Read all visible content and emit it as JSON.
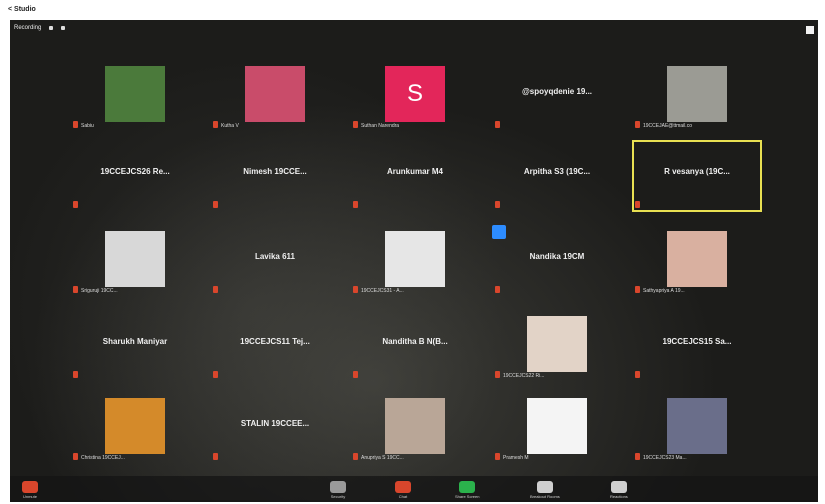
{
  "window": {
    "title": "< Studio"
  },
  "recording": {
    "label": "Recording"
  },
  "tiles": [
    {
      "name": "Sabiu",
      "kind": "photo",
      "photo_color": "#4b7a3b"
    },
    {
      "name": "Kutha V",
      "kind": "photo",
      "photo_color": "#c94c6a"
    },
    {
      "name": "Suthan Narendra",
      "kind": "letter",
      "letter": "S"
    },
    {
      "name": "@spoyqdenie 19...",
      "kind": "name"
    },
    {
      "name": "19CCEJAE@ttmail.co",
      "kind": "photo",
      "photo_color": "#9b9b94"
    },
    {
      "name": "19CCEJCS26 Re...",
      "kind": "name"
    },
    {
      "name": "Nimesh 19CCE...",
      "kind": "name"
    },
    {
      "name": "Arunkumar M4",
      "kind": "name"
    },
    {
      "name": "Arpitha S3 (19C...",
      "kind": "name"
    },
    {
      "name": "R vesanya (19C...",
      "kind": "name",
      "active": true
    },
    {
      "name": "Sriguruji 19CC...",
      "kind": "photo",
      "photo_color": "#d8d8d8"
    },
    {
      "name": "Lavika 611",
      "kind": "name"
    },
    {
      "name": "19CCEJCS31 - A...",
      "kind": "photo",
      "photo_color": "#e6e6e6"
    },
    {
      "name": "Nandika 19CM",
      "kind": "name"
    },
    {
      "name": "Sathyapriya A 19...",
      "kind": "photo",
      "photo_color": "#d9b0a0"
    },
    {
      "name": "Sharukh Maniyar",
      "kind": "name"
    },
    {
      "name": "19CCEJCS11 Tej...",
      "kind": "name"
    },
    {
      "name": "Nanditha B N(B...",
      "kind": "name"
    },
    {
      "name": "19CCEJCS22 Ri...",
      "kind": "photo",
      "photo_color": "#e2d3c7"
    },
    {
      "name": "19CCEJCS15 Sa...",
      "kind": "name"
    },
    {
      "name": "Christina 19CCEJ...",
      "kind": "photo",
      "photo_color": "#d48a2a"
    },
    {
      "name": "STALIN 19CCEE...",
      "kind": "name"
    },
    {
      "name": "Anupriya S 19CC...",
      "kind": "photo",
      "photo_color": "#b9a697"
    },
    {
      "name": "Pramesh M",
      "kind": "photo",
      "photo_color": "#f4f4f4"
    },
    {
      "name": "19CCEJCS23 Ma...",
      "kind": "photo",
      "photo_color": "#6a6e8a"
    }
  ],
  "toolbar": {
    "items": [
      {
        "label": "Unmute",
        "icon": "microphone-icon",
        "color": "#d9462c"
      },
      {
        "label": "Security",
        "icon": "shield-icon",
        "color": "#9a9a9a"
      },
      {
        "label": "Chat",
        "icon": "chat-icon",
        "color": "#d9462c"
      },
      {
        "label": "Share Screen",
        "icon": "share-screen-icon",
        "color": "#2bb24c"
      },
      {
        "label": "Breakout Rooms",
        "icon": "breakout-rooms-icon",
        "color": "#cfcfcf"
      },
      {
        "label": "Reactions",
        "icon": "reactions-icon",
        "color": "#cfcfcf"
      }
    ]
  }
}
